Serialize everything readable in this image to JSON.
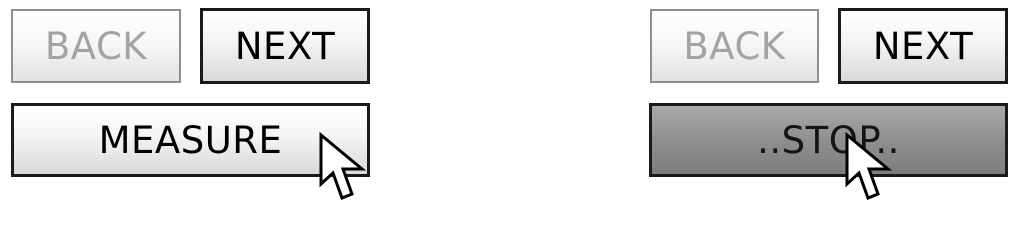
{
  "left_panel": {
    "back_label": "BACK",
    "next_label": "NEXT",
    "measure_label": "MEASURE"
  },
  "right_panel": {
    "back_label": "BACK",
    "next_label": "NEXT",
    "stop_label": "..STOP.."
  },
  "icons": {
    "cursor": "arrow-cursor-icon"
  },
  "colors": {
    "disabled_text": "#a3a3a3",
    "pressed_fill": "#8f8f8f",
    "border": "#1a1a1a"
  }
}
